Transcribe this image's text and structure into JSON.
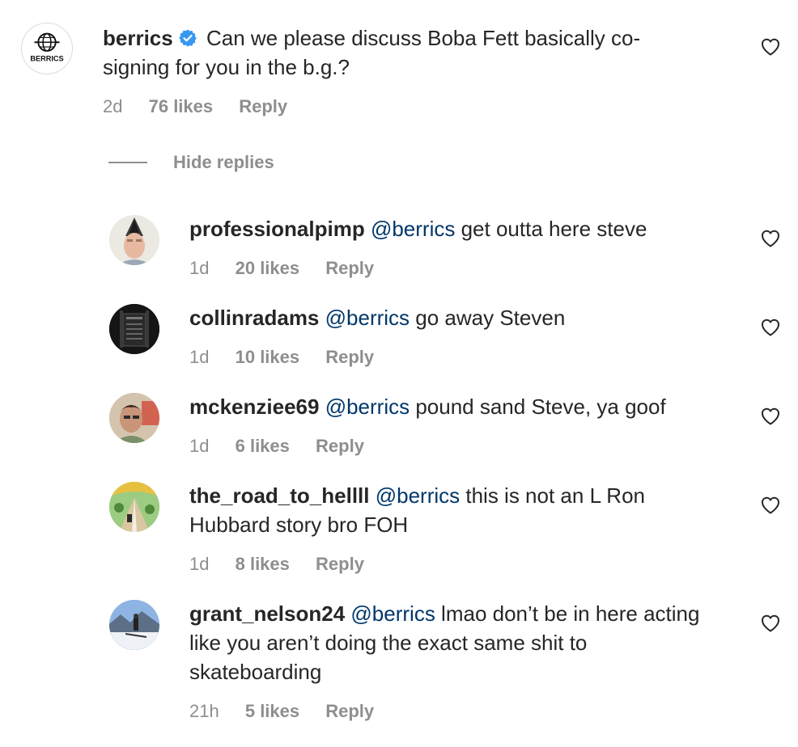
{
  "main_comment": {
    "username": "berrics",
    "avatar_text": "BERRICS",
    "text": "Can we please discuss Boba Fett basically co-signing for you in the b.g.?",
    "time": "2d",
    "likes": "76 likes",
    "reply": "Reply"
  },
  "hide_replies_label": "Hide replies",
  "replies": [
    {
      "username": "professionalpimp",
      "mention": "@berrics",
      "text": "get outta here steve",
      "time": "1d",
      "likes": "20 likes",
      "reply": "Reply"
    },
    {
      "username": "collinradams",
      "mention": "@berrics",
      "text": "go away Steven",
      "time": "1d",
      "likes": "10 likes",
      "reply": "Reply"
    },
    {
      "username": "mckenziee69",
      "mention": "@berrics",
      "text": "pound sand Steve, ya goof",
      "time": "1d",
      "likes": "6 likes",
      "reply": "Reply"
    },
    {
      "username": "the_road_to_hellll",
      "mention": "@berrics",
      "text": "this is not an L Ron Hubbard story bro FOH",
      "time": "1d",
      "likes": "8 likes",
      "reply": "Reply"
    },
    {
      "username": "grant_nelson24",
      "mention": "@berrics",
      "text": "lmao don’t be in here acting like you aren’t doing the exact same shit to skateboarding",
      "time": "21h",
      "likes": "5 likes",
      "reply": "Reply"
    }
  ],
  "icons": {
    "verified": "verified-badge-icon",
    "like": "heart-outline-icon"
  },
  "colors": {
    "mention": "#00376b",
    "meta": "#8e8e8e",
    "verified": "#3897f0"
  }
}
